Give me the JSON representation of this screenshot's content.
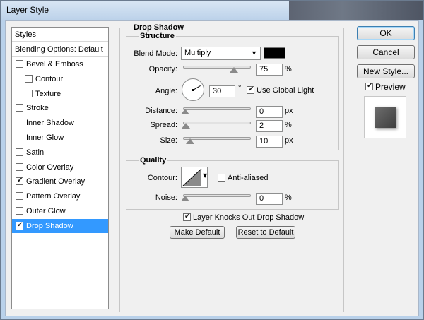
{
  "window": {
    "title": "Layer Style"
  },
  "styles_list": {
    "header": "Styles",
    "blending_options": "Blending Options: Default",
    "items": [
      {
        "label": "Bevel & Emboss",
        "checked": false,
        "indent": false,
        "selected": false
      },
      {
        "label": "Contour",
        "checked": false,
        "indent": true,
        "selected": false
      },
      {
        "label": "Texture",
        "checked": false,
        "indent": true,
        "selected": false
      },
      {
        "label": "Stroke",
        "checked": false,
        "indent": false,
        "selected": false
      },
      {
        "label": "Inner Shadow",
        "checked": false,
        "indent": false,
        "selected": false
      },
      {
        "label": "Inner Glow",
        "checked": false,
        "indent": false,
        "selected": false
      },
      {
        "label": "Satin",
        "checked": false,
        "indent": false,
        "selected": false
      },
      {
        "label": "Color Overlay",
        "checked": false,
        "indent": false,
        "selected": false
      },
      {
        "label": "Gradient Overlay",
        "checked": true,
        "indent": false,
        "selected": false
      },
      {
        "label": "Pattern Overlay",
        "checked": false,
        "indent": false,
        "selected": false
      },
      {
        "label": "Outer Glow",
        "checked": false,
        "indent": false,
        "selected": false
      },
      {
        "label": "Drop Shadow",
        "checked": true,
        "indent": false,
        "selected": true
      }
    ]
  },
  "drop_shadow": {
    "title": "Drop Shadow",
    "structure": {
      "title": "Structure",
      "blend_mode_label": "Blend Mode:",
      "blend_mode_value": "Multiply",
      "shadow_color": "#000000",
      "opacity_label": "Opacity:",
      "opacity_value": "75",
      "opacity_unit": "%",
      "opacity_fraction": 0.75,
      "angle_label": "Angle:",
      "angle_value": "30",
      "angle_unit": "°",
      "use_global_light_label": "Use Global Light",
      "use_global_light_checked": true,
      "distance_label": "Distance:",
      "distance_value": "0",
      "distance_unit": "px",
      "spread_label": "Spread:",
      "spread_value": "2",
      "spread_unit": "%",
      "size_label": "Size:",
      "size_value": "10",
      "size_unit": "px"
    },
    "quality": {
      "title": "Quality",
      "contour_label": "Contour:",
      "anti_aliased_label": "Anti-aliased",
      "anti_aliased_checked": false,
      "noise_label": "Noise:",
      "noise_value": "0",
      "noise_unit": "%"
    },
    "knocks_out_label": "Layer Knocks Out Drop Shadow",
    "knocks_out_checked": true,
    "make_default_label": "Make Default",
    "reset_default_label": "Reset to Default"
  },
  "actions": {
    "ok_label": "OK",
    "cancel_label": "Cancel",
    "new_style_label": "New Style...",
    "preview_label": "Preview",
    "preview_checked": true
  }
}
